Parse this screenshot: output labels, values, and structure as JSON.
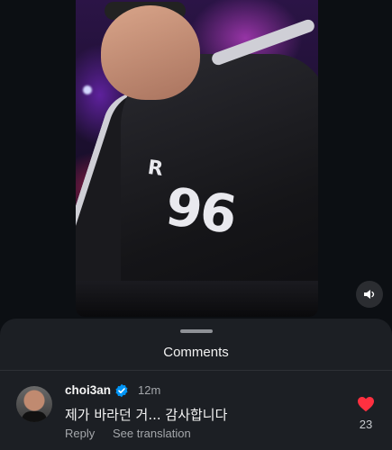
{
  "video": {
    "jersey_number": "96",
    "jersey_text": "R"
  },
  "comments_sheet": {
    "title": "Comments"
  },
  "comment": {
    "username": "choi3an",
    "time": "12m",
    "text": "제가 바라던 거... 감사합니다",
    "reply_label": "Reply",
    "translation_label": "See translation",
    "like_count": "23",
    "liked": true
  },
  "colors": {
    "like_red": "#ff3040",
    "verified_blue": "#0095f6",
    "sheet_bg": "#1c1f24",
    "page_bg": "#0c0f13"
  },
  "icons": {
    "mute": "speaker-icon",
    "verified": "verified-badge-icon",
    "like": "heart-icon"
  }
}
